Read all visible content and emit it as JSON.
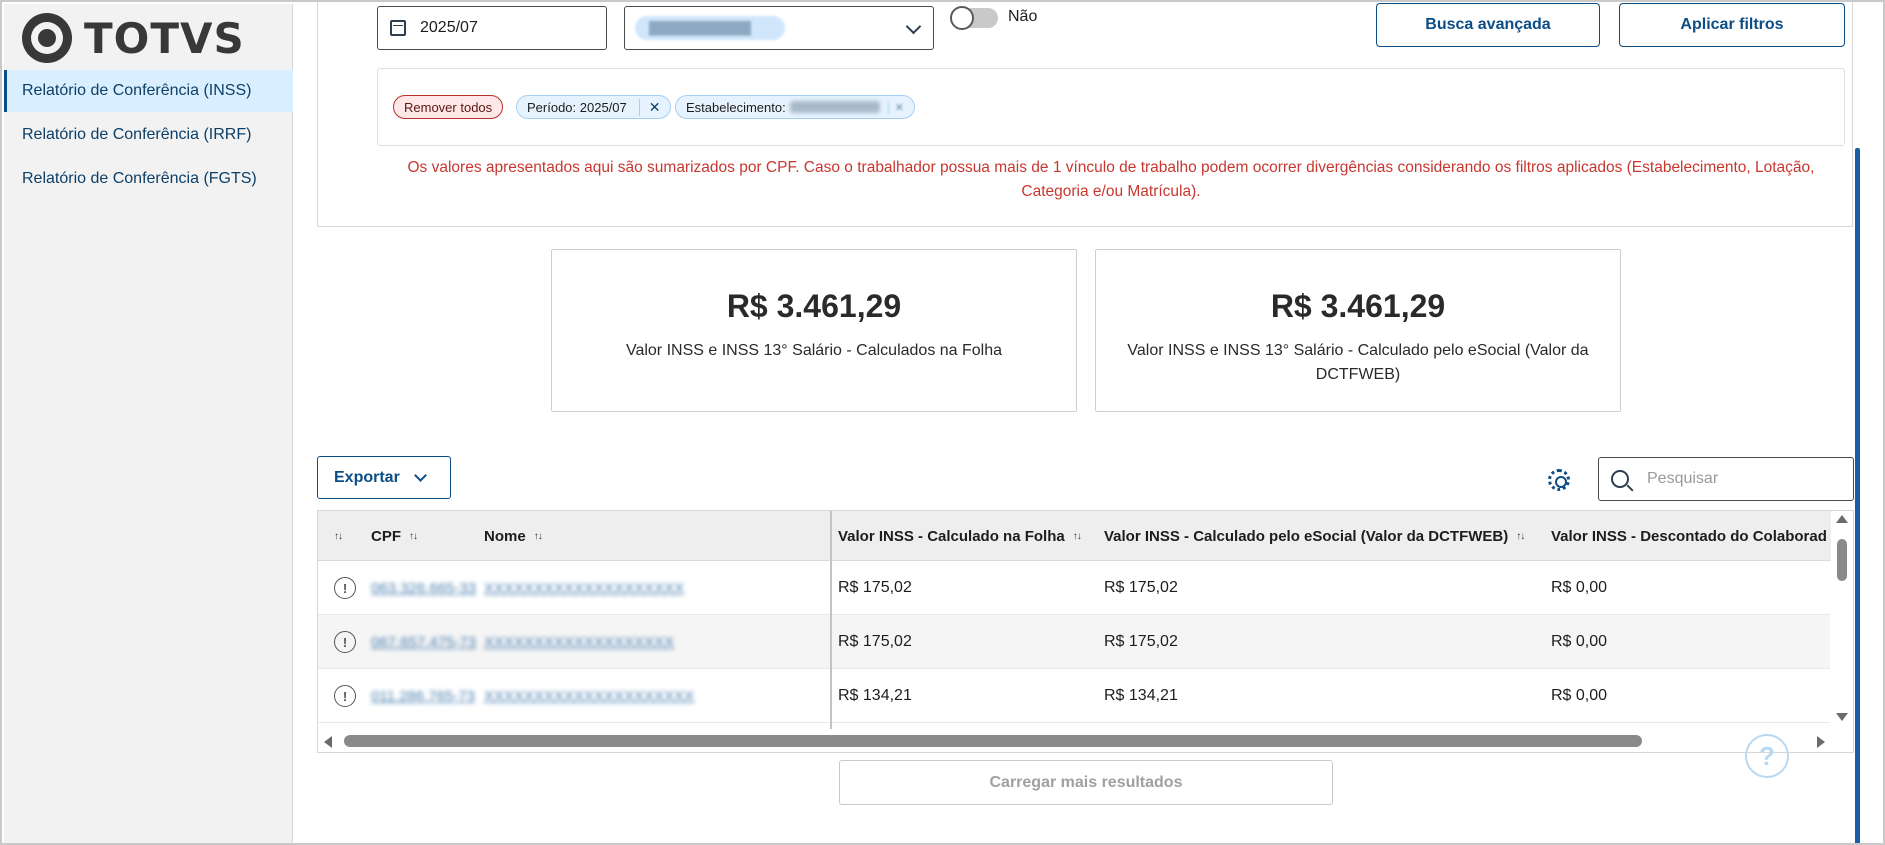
{
  "brand": {
    "name": "TOTVS"
  },
  "sidebar": {
    "items": [
      {
        "label": "Relatório de Conferência (INSS)",
        "active": true
      },
      {
        "label": "Relatório de Conferência (IRRF)",
        "active": false
      },
      {
        "label": "Relatório de Conferência (FGTS)",
        "active": false
      }
    ]
  },
  "filters": {
    "period_value": "2025/07",
    "establishment_value": "████████████",
    "toggle_label": "Não",
    "toggle_on": false,
    "advanced_search_label": "Busca avançada",
    "apply_filters_label": "Aplicar filtros",
    "chips": {
      "remove_all": "Remover todos",
      "period": "Período: 2025/07",
      "period_close": "✕",
      "establishment": "Estabelecimento:"
    },
    "warning": "Os valores apresentados aqui são sumarizados por CPF. Caso o trabalhador possua mais de 1 vínculo de trabalho podem ocorrer divergências considerando os filtros aplicados (Estabelecimento, Lotação, Categoria e/ou Matrícula)."
  },
  "kpis": [
    {
      "value": "R$ 3.461,29",
      "label": "Valor INSS e INSS 13° Salário - Calculados na Folha"
    },
    {
      "value": "R$ 3.461,29",
      "label": "Valor INSS e INSS 13° Salário - Calculado pelo eSocial (Valor da DCTFWEB)"
    }
  ],
  "toolbar": {
    "export_label": "Exportar",
    "search_placeholder": "Pesquisar"
  },
  "table": {
    "columns": [
      "",
      "CPF",
      "Nome",
      "Valor INSS - Calculado na Folha",
      "Valor INSS - Calculado pelo eSocial (Valor da DCTFWEB)",
      "Valor INSS - Descontado do Colaborad"
    ],
    "rows": [
      {
        "cpf": "063.326.665-33",
        "nome": "XXXXXXXXXXXXXXXXXXXX",
        "folha": "R$ 175,02",
        "esocial": "R$ 175,02",
        "descontado": "R$ 0,00"
      },
      {
        "cpf": "067.657.475-73",
        "nome": "XXXXXXXXXXXXXXXXXXX",
        "folha": "R$ 175,02",
        "esocial": "R$ 175,02",
        "descontado": "R$ 0,00"
      },
      {
        "cpf": "011.286.765-73",
        "nome": "XXXXXXXXXXXXXXXXXXXXX",
        "folha": "R$ 134,21",
        "esocial": "R$ 134,21",
        "descontado": "R$ 0,00"
      }
    ],
    "sort_glyph": "↑↓",
    "row_icon": "!"
  },
  "load_more_label": "Carregar mais resultados",
  "help_glyph": "?",
  "icons": {
    "calendar": "calendar-icon",
    "chevron": "chevron-down-icon",
    "settings": "gear-icon",
    "search": "search-icon",
    "warning": "exclamation-circle-icon",
    "help": "help-icon"
  },
  "colors": {
    "primary": "#0c4d86",
    "warning_text": "#c8372f",
    "active_bg": "#d9efff"
  }
}
